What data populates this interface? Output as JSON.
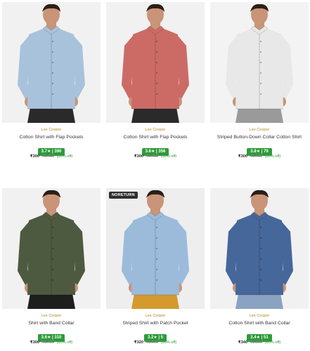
{
  "products": [
    {
      "brand": "Lee Cooper",
      "name": "Cotton Shirt with Flap Pockets",
      "rating": "3.7★ | 390",
      "price": "₹300",
      "mrp": "₹1,499",
      "discount": "(80% off)",
      "badge": "",
      "shirt_color": "#a9c2dc",
      "pants_color": "#2a2a2a",
      "bg": "#f1f1f1"
    },
    {
      "brand": "Lee Cooper",
      "name": "Cotton Shirt with Flap Pockets",
      "rating": "3.6★ | 356",
      "price": "₹300",
      "mrp": "₹1,499",
      "discount": "(80% off)",
      "badge": "",
      "shirt_color": "#cc6b66",
      "pants_color": "#2a2a2a",
      "bg": "#f1f1f1"
    },
    {
      "brand": "Lee Cooper",
      "name": "Striped Button-Down Collar Cotton Shirt",
      "rating": "3.8★ | 79",
      "price": "₹300",
      "mrp": "₹1,499",
      "discount": "(80% off)",
      "badge": "",
      "shirt_color": "#e8e8e8",
      "pants_color": "#9a9a9a",
      "bg": "#f3f3f3"
    },
    {
      "brand": "Lee Cooper",
      "name": "Shirt with Band Collar",
      "rating": "3.6★ | 310",
      "price": "₹300",
      "mrp": "₹1,499",
      "discount": "(80% off)",
      "badge": "",
      "shirt_color": "#4d5a40",
      "pants_color": "#1e1e1e",
      "bg": "#f1f1f1"
    },
    {
      "brand": "Lee Cooper",
      "name": "Striped Shirt with Patch Pocket",
      "rating": "3.2★ | 5",
      "price": "₹320",
      "mrp": "₹1,599",
      "discount": "(80% off)",
      "badge": "NORETURN",
      "shirt_color": "#9cbbdb",
      "pants_color": "#d49a2e",
      "bg": "#eeeeee"
    },
    {
      "brand": "Lee Cooper",
      "name": "Cotton Shirt with Band Collar",
      "rating": "3.4★ | 51",
      "price": "₹340",
      "mrp": "₹1,699",
      "discount": "(80% off)",
      "badge": "",
      "shirt_color": "#46679a",
      "pants_color": "#8aa3c2",
      "bg": "#f1f1f1"
    }
  ]
}
